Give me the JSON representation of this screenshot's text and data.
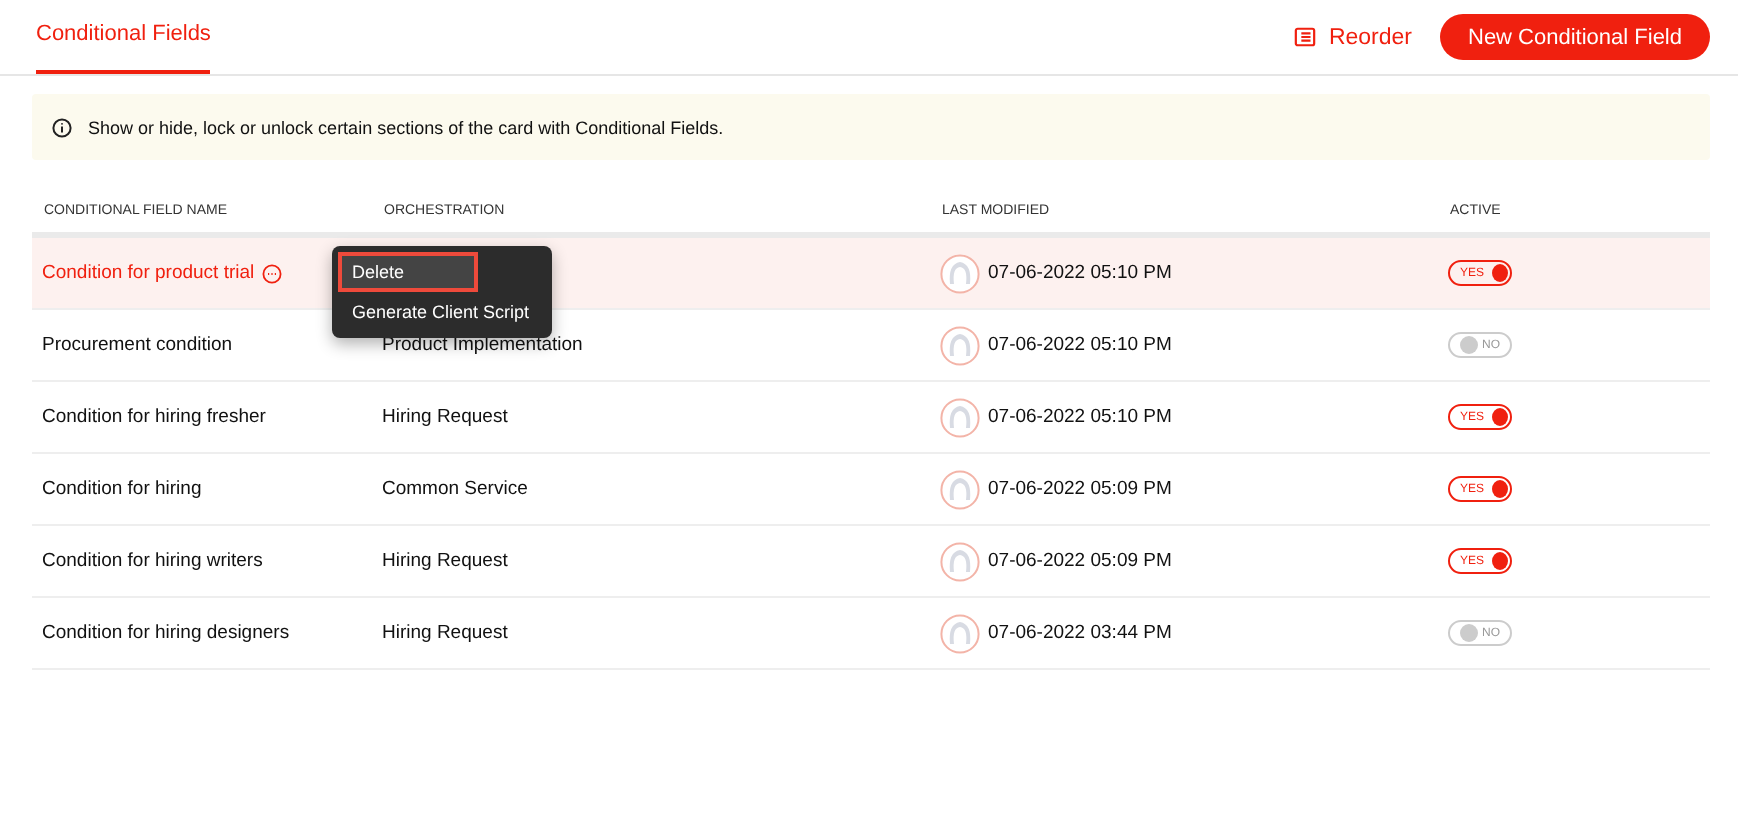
{
  "header": {
    "tabs": [
      {
        "label": "Conditional Fields",
        "selected": true
      }
    ],
    "reorder_label": "Reorder",
    "new_button": "New Conditional Field"
  },
  "info_banner": "Show or hide, lock or unlock certain sections of the card with Conditional Fields.",
  "table": {
    "columns": [
      "CONDITIONAL FIELD NAME",
      "ORCHESTRATION",
      "LAST MODIFIED",
      "ACTIVE"
    ],
    "rows": [
      {
        "name": "Condition for product trial",
        "orchestration": "",
        "last_modified": "07-06-2022 05:10 PM",
        "active": true,
        "active_label": "YES",
        "selected": true,
        "menu": [
          {
            "label": "Delete",
            "selected": true
          },
          {
            "label": "Generate Client Script",
            "selected": false
          }
        ]
      },
      {
        "name": "Procurement condition",
        "orchestration": "Product Implementation",
        "last_modified": "07-06-2022 05:10 PM",
        "active": false,
        "active_label": "NO",
        "selected": false
      },
      {
        "name": "Condition for hiring fresher",
        "orchestration": "Hiring Request",
        "last_modified": "07-06-2022 05:10 PM",
        "active": true,
        "active_label": "YES",
        "selected": false
      },
      {
        "name": "Condition for hiring",
        "orchestration": "Common Service",
        "last_modified": "07-06-2022 05:09 PM",
        "active": true,
        "active_label": "YES",
        "selected": false
      },
      {
        "name": "Condition for hiring writers",
        "orchestration": "Hiring Request",
        "last_modified": "07-06-2022 05:09 PM",
        "active": true,
        "active_label": "YES",
        "selected": false
      },
      {
        "name": "Condition for hiring designers",
        "orchestration": "Hiring Request",
        "last_modified": "07-06-2022 03:44 PM",
        "active": false,
        "active_label": "NO",
        "selected": false
      }
    ]
  }
}
